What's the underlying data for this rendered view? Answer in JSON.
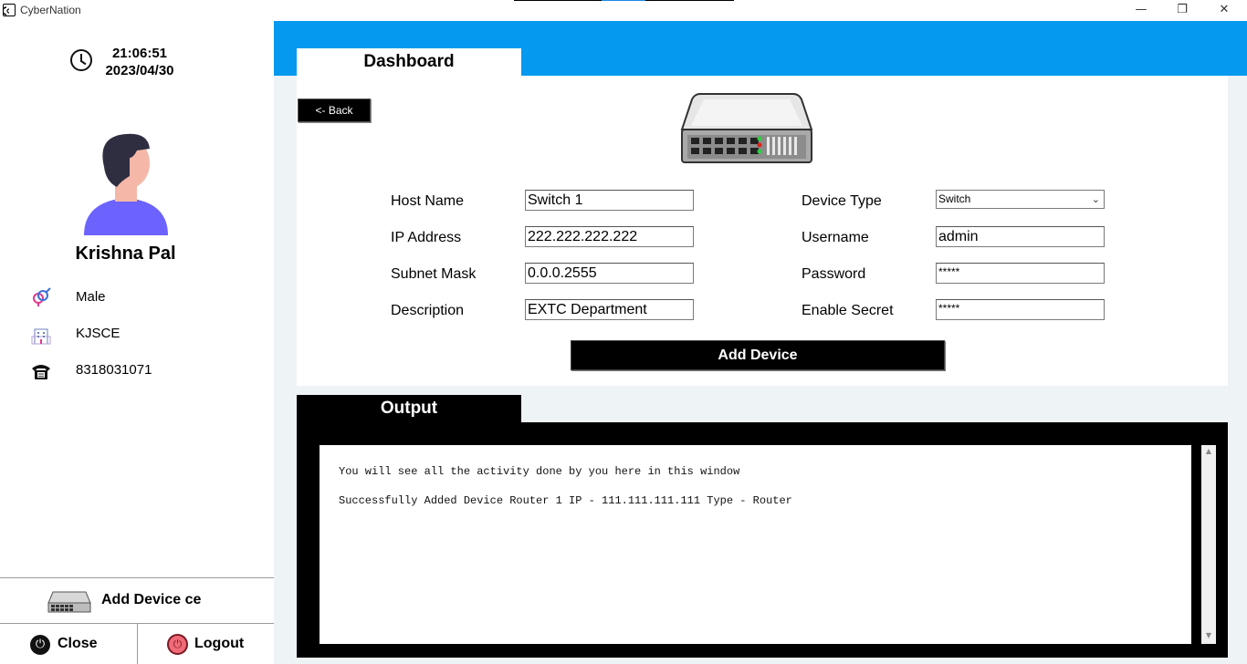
{
  "window": {
    "title": "CyberNation",
    "minimize_glyph": "—",
    "restore_glyph": "❐",
    "close_glyph": "✕"
  },
  "sidebar": {
    "time": "21:06:51",
    "date": "2023/04/30",
    "user_name": "Krishna Pal",
    "gender": "Male",
    "institution": "KJSCE",
    "phone": "8318031071",
    "add_device_label": "Add Device ce",
    "close_label": "Close",
    "logout_label": "Logout",
    "icons": {
      "clock": "clock-icon",
      "gender": "gender-icon",
      "institution": "building-icon",
      "phone": "telephone-icon",
      "add_device": "network-switch-icon",
      "close": "power-icon",
      "logout": "power-icon"
    }
  },
  "dashboard": {
    "tab_label": "Dashboard",
    "back_label": "<- Back",
    "fields_left": [
      {
        "label": "Host Name",
        "value": "Switch 1"
      },
      {
        "label": "IP Address",
        "value": "222.222.222.222"
      },
      {
        "label": "Subnet Mask",
        "value": "0.0.0.2555"
      },
      {
        "label": "Description",
        "value": "EXTC Department"
      }
    ],
    "fields_right": [
      {
        "label": "Device Type",
        "value": "Switch"
      },
      {
        "label": "Username",
        "value": "admin"
      },
      {
        "label": "Password",
        "value": "*****"
      },
      {
        "label": "Enable Secret",
        "value": "*****"
      }
    ],
    "add_device_button": "Add Device"
  },
  "output": {
    "tab_label": "Output",
    "lines": [
      "You will see all the activity done by you here in this window",
      "Successfully Added Device Router 1 IP - 111.111.111.111 Type - Router"
    ]
  },
  "colors": {
    "header_blue": "#0599f0",
    "panel_bg": "#eef3f6",
    "avatar_shirt": "#6c63ff",
    "logout_red": "#f06b78"
  }
}
